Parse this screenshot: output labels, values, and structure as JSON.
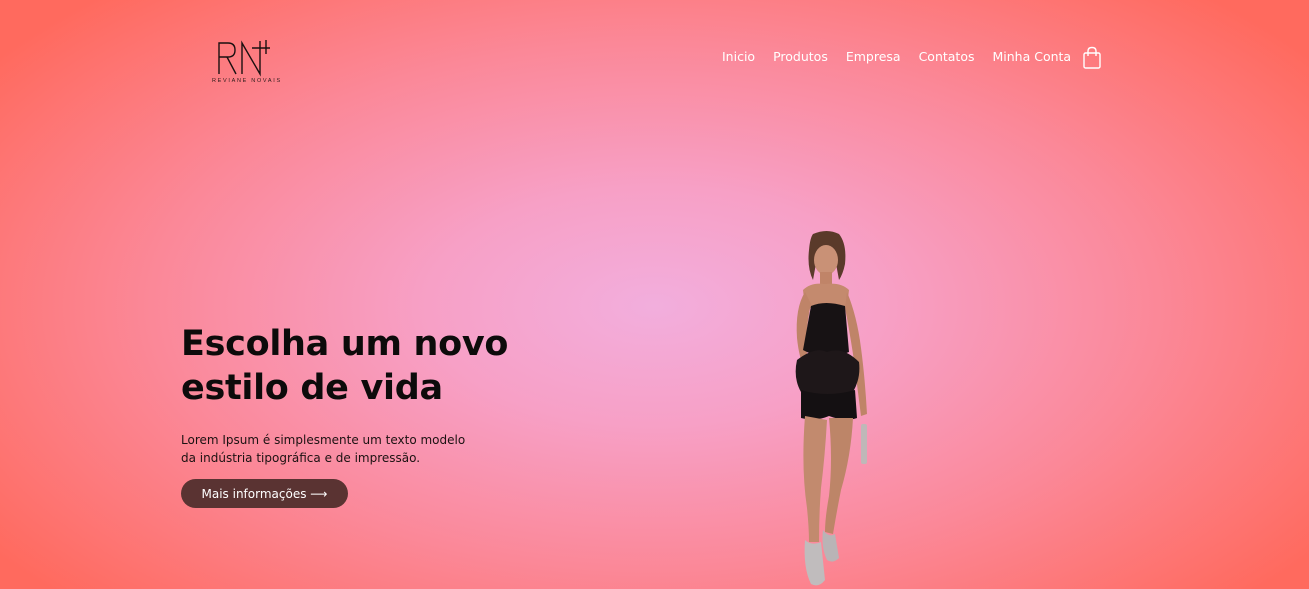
{
  "brand": {
    "logo_monogram": "RN",
    "logo_subtitle": "REVIANE NOVAIS"
  },
  "nav": {
    "items": [
      {
        "label": "Inicio"
      },
      {
        "label": "Produtos"
      },
      {
        "label": "Empresa"
      },
      {
        "label": "Contatos"
      },
      {
        "label": "Minha Conta"
      }
    ],
    "cart_icon": "shopping-bag-icon"
  },
  "hero": {
    "title": "Escolha um novo estilo de vida",
    "text_line1": "Lorem Ipsum é simplesmente um texto modelo",
    "text_line2": "da indústria tipográfica e de impressão.",
    "cta_label": "Mais informações ⟶"
  },
  "colors": {
    "background_center": "#f2aedd",
    "background_edge": "#ff6a5e",
    "cta_background": "#5a3332",
    "text_dark": "#0d0b0b",
    "nav_text": "#ffffff"
  }
}
